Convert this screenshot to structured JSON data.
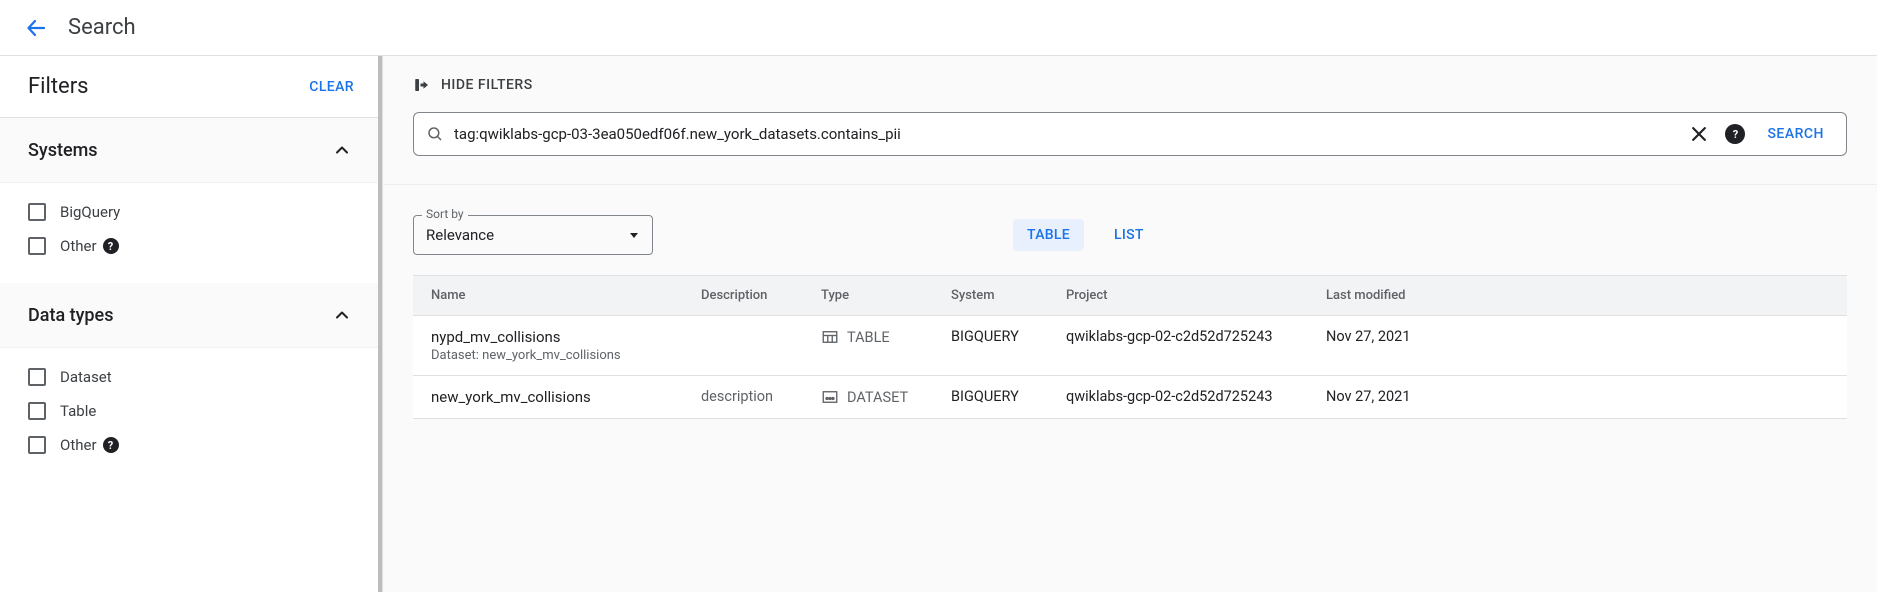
{
  "header": {
    "title": "Search"
  },
  "sidebar": {
    "filters_title": "Filters",
    "clear_label": "CLEAR",
    "sections": [
      {
        "title": "Systems",
        "options": [
          {
            "label": "BigQuery",
            "help": false
          },
          {
            "label": "Other",
            "help": true
          }
        ]
      },
      {
        "title": "Data types",
        "options": [
          {
            "label": "Dataset",
            "help": false
          },
          {
            "label": "Table",
            "help": false
          },
          {
            "label": "Other",
            "help": true
          }
        ]
      }
    ]
  },
  "toolbar": {
    "hide_filters_label": "HIDE FILTERS",
    "search_value": "tag:qwiklabs-gcp-03-3ea050edf06f.new_york_datasets.contains_pii",
    "search_button": "SEARCH"
  },
  "controls": {
    "sort_label": "Sort by",
    "sort_value": "Relevance",
    "view_table": "TABLE",
    "view_list": "LIST"
  },
  "table": {
    "columns": {
      "name": "Name",
      "description": "Description",
      "type": "Type",
      "system": "System",
      "project": "Project",
      "last_modified": "Last modified"
    },
    "rows": [
      {
        "name": "nypd_mv_collisions",
        "subtitle": "Dataset: new_york_mv_collisions",
        "description": "",
        "type": "TABLE",
        "system": "BIGQUERY",
        "project": "qwiklabs-gcp-02-c2d52d725243",
        "last_modified": "Nov 27, 2021"
      },
      {
        "name": "new_york_mv_collisions",
        "subtitle": "",
        "description": "description",
        "type": "DATASET",
        "system": "BIGQUERY",
        "project": "qwiklabs-gcp-02-c2d52d725243",
        "last_modified": "Nov 27, 2021"
      }
    ]
  }
}
